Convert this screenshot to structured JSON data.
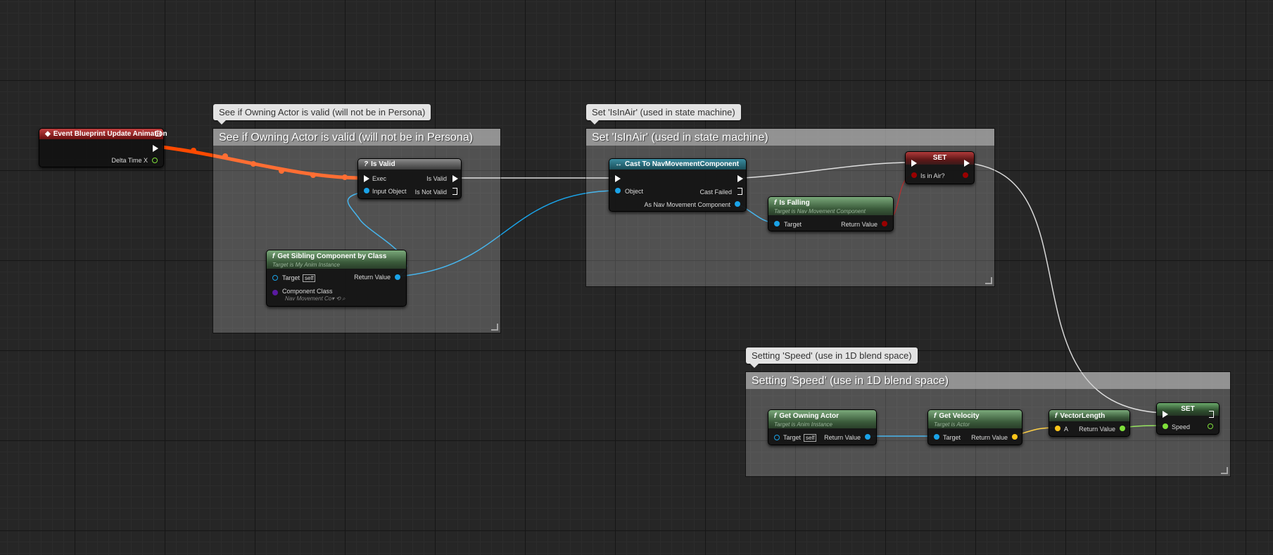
{
  "comments": {
    "valid": "See if Owning Actor is valid (will not be in Persona)",
    "isinair": "Set 'IsInAir' (used in state machine)",
    "speed": "Setting 'Speed' (use in 1D blend space)"
  },
  "nodes": {
    "event": {
      "title": "Event Blueprint Update Animation",
      "pin_delta": "Delta Time X"
    },
    "isvalid": {
      "title": "Is Valid",
      "glyph": "?",
      "pin_exec": "Exec",
      "pin_input": "Input Object",
      "pin_valid": "Is Valid",
      "pin_notvalid": "Is Not Valid"
    },
    "sibling": {
      "title": "Get Sibling Component by Class",
      "subtitle": "Target is My Anim Instance",
      "pin_target": "Target",
      "self": "self",
      "pin_class": "Component Class",
      "class_value": "Nav Movement Co",
      "pin_return": "Return Value"
    },
    "cast": {
      "title": "Cast To NavMovementComponent",
      "glyph": "↔",
      "pin_object": "Object",
      "pin_failed": "Cast Failed",
      "pin_as": "As Nav Movement Component"
    },
    "isfalling": {
      "title": "Is Falling",
      "subtitle": "Target is Nav Movement Component",
      "pin_target": "Target",
      "pin_return": "Return Value"
    },
    "set_air": {
      "title": "SET",
      "pin_air": "Is in Air?"
    },
    "owning": {
      "title": "Get Owning Actor",
      "subtitle": "Target is Anim Instance",
      "pin_target": "Target",
      "self": "self",
      "pin_return": "Return Value"
    },
    "velocity": {
      "title": "Get Velocity",
      "subtitle": "Target is Actor",
      "pin_target": "Target",
      "pin_return": "Return Value"
    },
    "vlength": {
      "title": "VectorLength",
      "pin_a": "A",
      "pin_return": "Return Value"
    },
    "set_speed": {
      "title": "SET",
      "pin_speed": "Speed"
    }
  },
  "fn_glyph": "f",
  "colors": {
    "exec_wire": "#d8d8d8",
    "active_wire": "#ff4a00",
    "object_pin": "#1aa3e8",
    "vector_pin": "#ffc61a",
    "float_pin": "#7fe03a",
    "bool_pin": "#9a0000",
    "class_pin": "#5a1aa0"
  }
}
